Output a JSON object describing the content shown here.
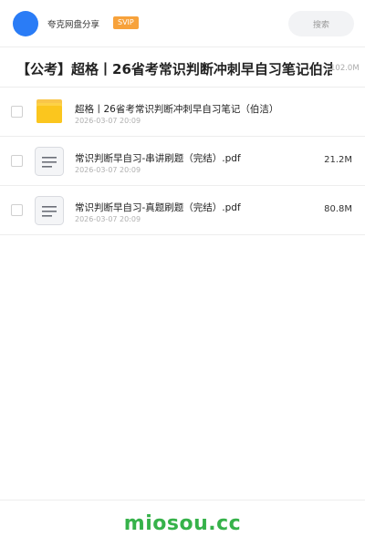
{
  "header": {
    "site_name": "夸克网盘分享",
    "badge": "SVIP",
    "search_placeholder": "搜索",
    "accent_color": "#2a7cf6",
    "badge_color": "#f7a23b"
  },
  "share": {
    "title": "【公考】超格丨26省考常识判断冲刺早自习笔记伯洁",
    "total_size": "102.0M"
  },
  "files": [
    {
      "type": "folder",
      "icon": "folder-icon",
      "name": "超格丨26省考常识判断冲刺早自习笔记（伯洁）",
      "date": "2026-03-07 20:09",
      "size": ""
    },
    {
      "type": "file",
      "icon": "document-icon",
      "name": "常识判断早自习-串讲刷题（完结）.pdf",
      "date": "2026-03-07 20:09",
      "size": "21.2M"
    },
    {
      "type": "file",
      "icon": "document-icon",
      "name": "常识判断早自习-真题刷题（完结）.pdf",
      "date": "2026-03-07 20:09",
      "size": "80.8M"
    }
  ],
  "footer": {
    "brand": "miosou.cc",
    "brand_color": "#36b24a"
  }
}
